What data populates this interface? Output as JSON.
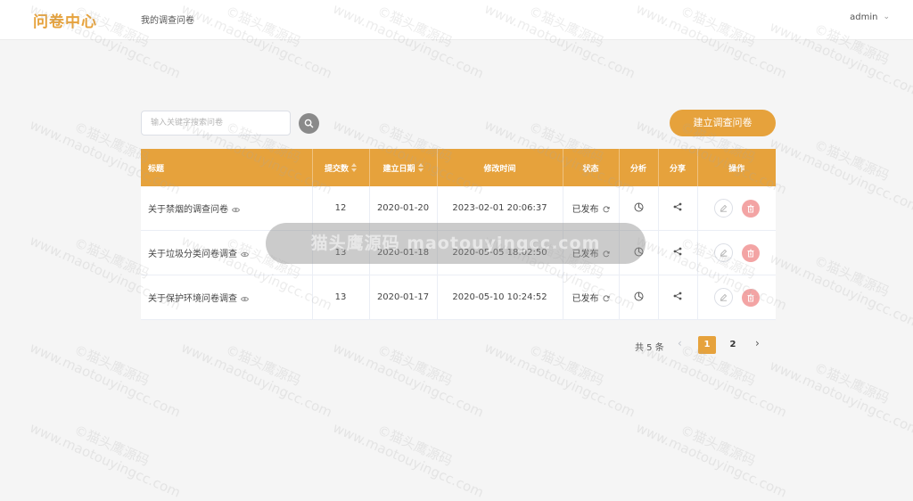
{
  "header": {
    "brand": "问卷中心",
    "nav_link": "我的调查问卷",
    "user": "admin"
  },
  "toolbar": {
    "search_placeholder": "输入关键字搜索问卷",
    "search_value": "",
    "create_label": "建立调查问卷"
  },
  "table": {
    "columns": {
      "title": "标题",
      "submissions": "提交数",
      "created": "建立日期",
      "modified": "修改时间",
      "status": "状态",
      "analysis": "分析",
      "share": "分享",
      "actions": "操作"
    },
    "rows": [
      {
        "title": "关于禁烟的调查问卷",
        "submissions": "12",
        "created": "2020-01-20",
        "modified": "2023-02-01 20:06:37",
        "status": "已发布"
      },
      {
        "title": "关于垃圾分类问卷调查",
        "submissions": "13",
        "created": "2020-01-18",
        "modified": "2020-05-05 18:02:50",
        "status": "已发布"
      },
      {
        "title": "关于保护环境问卷调查",
        "submissions": "13",
        "created": "2020-01-17",
        "modified": "2020-05-10 10:24:52",
        "status": "已发布"
      }
    ]
  },
  "pagination": {
    "total": "共 5 条",
    "pages": [
      "1",
      "2"
    ],
    "current": "1"
  },
  "overlay": {
    "text": "猫头鹰源码 maotouyingcc.com"
  },
  "watermark": {
    "line1": "©猫头鹰源码",
    "line2": "www.maotouyingcc.com"
  },
  "colors": {
    "accent": "#e6a23c",
    "delete": "#f3a4a4",
    "background": "#f5f5f5"
  }
}
